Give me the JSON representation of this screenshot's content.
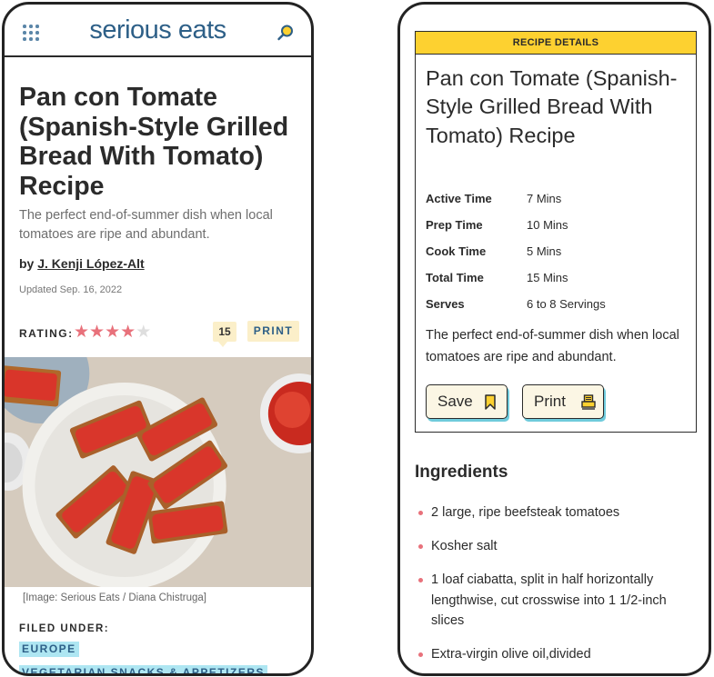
{
  "left": {
    "logo": "serious eats",
    "title": "Pan con Tomate (Spanish-Style Grilled Bread With Tomato) Recipe",
    "subtitle": "The perfect end-of-summer dish when local tomatoes are ripe and abundant.",
    "byline_prefix": "by",
    "author": "J. Kenji López-Alt",
    "updated": "Updated Sep. 16, 2022",
    "rating_label": "RATING:",
    "rating": 4,
    "rating_max": 5,
    "comment_count": "15",
    "print_label": "PRINT",
    "photo_caption": "[Image: Serious Eats / Diana Chistruga]",
    "filed_under_label": "FILED UNDER:",
    "tags": [
      "EUROPE",
      "VEGETARIAN SNACKS & APPETIZERS"
    ]
  },
  "right": {
    "card_header": "RECIPE DETAILS",
    "title": "Pan con Tomate (Spanish-Style Grilled Bread With Tomato) Recipe",
    "meta": [
      {
        "label": "Active Time",
        "value": "7 Mins"
      },
      {
        "label": "Prep Time",
        "value": "10 Mins"
      },
      {
        "label": "Cook Time",
        "value": "5 Mins"
      },
      {
        "label": "Total Time",
        "value": "15 Mins"
      },
      {
        "label": "Serves",
        "value": "6 to 8 Servings"
      }
    ],
    "description": "The perfect end-of-summer dish when local tomatoes are ripe and abundant.",
    "save_label": "Save",
    "print_label": "Print",
    "ingredients_title": "Ingredients",
    "ingredients": [
      "2 large, ripe beefsteak tomatoes",
      "Kosher salt",
      "1 loaf ciabatta, split in half horizontally lengthwise, cut crosswise into 1 1/2-inch slices",
      "Extra-virgin olive oil,divided"
    ]
  },
  "colors": {
    "brand_blue": "#2d5f87",
    "accent_yellow": "#fdd130",
    "star_pink": "#e8717b",
    "tag_cyan": "#aee6f2",
    "button_shadow": "#6fcbdc"
  }
}
